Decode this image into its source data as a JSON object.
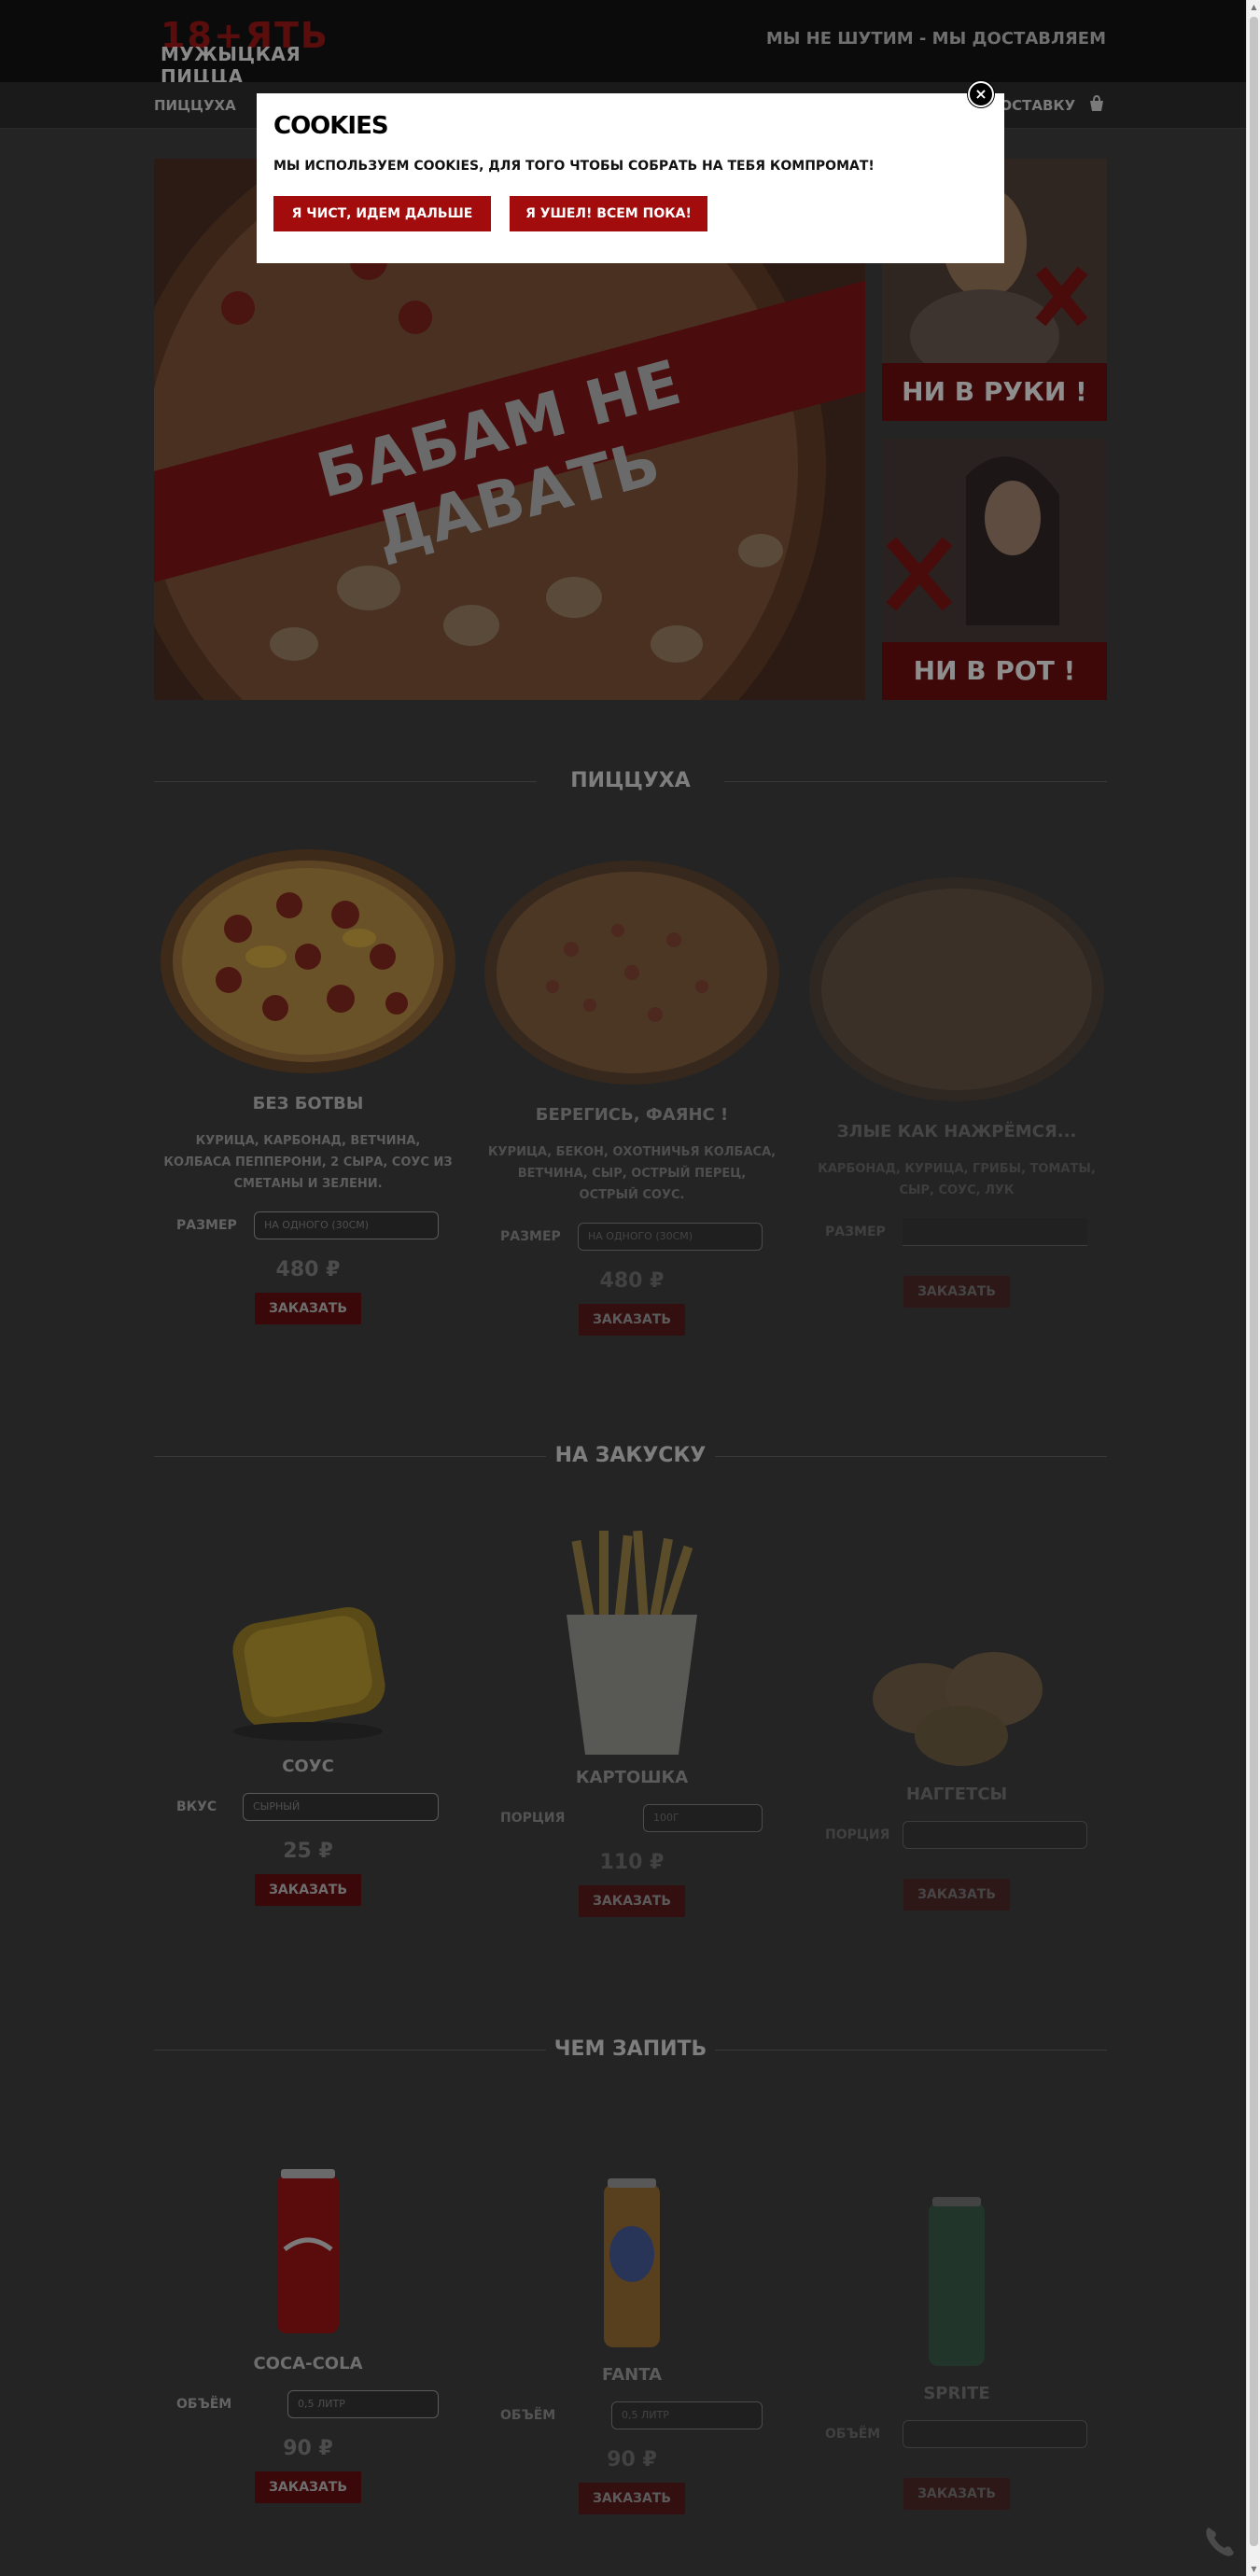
{
  "header": {
    "logo_top": "18+ЯТЬ",
    "logo_sub": "МУЖЫЦКАЯ ПИЦЦА",
    "tagline": "МЫ НЕ ШУТИМ - МЫ ДОСТАВЛЯЕМ"
  },
  "nav": {
    "items": [
      {
        "label": "ПИЦЦУХА"
      },
      {
        "label": "ДОСТАВКУ"
      }
    ]
  },
  "hero": {
    "main_text": "БАБАМ НЕ ДАВАТЬ",
    "side_top_caption": "НИ В РУКИ !",
    "side_bottom_caption": "НИ В РОТ !"
  },
  "sections": {
    "pizza": "ПИЦЦУХА",
    "snacks": "НА ЗАКУСКУ",
    "drinks": "ЧЕМ ЗАПИТЬ"
  },
  "pizzas": [
    {
      "name": "БЕЗ БОТВЫ",
      "desc": "КУРИЦА, КАРБОНАД, ВЕТЧИНА, КОЛБАСА ПЕППЕРОНИ, 2 СЫРА, СОУС ИЗ СМЕТАНЫ И ЗЕЛЕНИ.",
      "option_label": "РАЗМЕР",
      "option_value": "НА ОДНОГО (30СМ)",
      "price": "480 ₽",
      "order": "ЗАКАЗАТЬ"
    },
    {
      "name": "БЕРЕГИСЬ, ФАЯНС !",
      "desc": "КУРИЦА, БЕКОН, ОХОТНИЧЬЯ КОЛБАСА, ВЕТЧИНА, СЫР, ОСТРЫЙ ПЕРЕЦ, ОСТРЫЙ СОУС.",
      "option_label": "РАЗМЕР",
      "option_value": "НА ОДНОГО (30СМ)",
      "price": "480 ₽",
      "order": "ЗАКАЗАТЬ"
    },
    {
      "name": "ЗЛЫЕ КАК НАЖРЁМСЯ...",
      "desc": "КАРБОНАД, КУРИЦА, ГРИБЫ, ТОМАТЫ, СЫР, СОУС, ЛУК",
      "option_label": "РАЗМЕР",
      "option_value": "",
      "price": "",
      "order": "ЗАКАЗАТЬ"
    }
  ],
  "snacks": [
    {
      "name": "СОУС",
      "option_label": "ВКУС",
      "option_value": "СЫРНЫЙ",
      "price": "25 ₽",
      "order": "ЗАКАЗАТЬ"
    },
    {
      "name": "КАРТОШКА",
      "option_label": "ПОРЦИЯ",
      "option_value": "100Г",
      "price": "110 ₽",
      "order": "ЗАКАЗАТЬ"
    },
    {
      "name": "НАГГЕТСЫ",
      "option_label": "ПОРЦИЯ",
      "option_value": "",
      "price": "",
      "order": "ЗАКАЗАТЬ"
    }
  ],
  "drinks": [
    {
      "name": "COCA-COLA",
      "option_label": "ОБЪЁМ",
      "option_value": "0,5 ЛИТР",
      "price": "90 ₽",
      "order": "ЗАКАЗАТЬ"
    },
    {
      "name": "FANTA",
      "option_label": "ОБЪЁМ",
      "option_value": "0,5 ЛИТР",
      "price": "90 ₽",
      "order": "ЗАКАЗАТЬ"
    },
    {
      "name": "SPRITE",
      "option_label": "ОБЪЁМ",
      "option_value": "",
      "price": "",
      "order": "ЗАКАЗАТЬ"
    }
  ],
  "cookie_modal": {
    "title": "COOKIES",
    "text": "МЫ ИСПОЛЬЗУЕМ COOKIES, ДЛЯ ТОГО ЧТОБЫ СОБРАТЬ НА ТЕБЯ КОМПРОМАТ!",
    "accept": "Я ЧИСТ, ИДЕМ ДАЛЬШЕ",
    "decline": "Я УШЕЛ! ВСЕМ ПОКА!",
    "close": "×"
  },
  "colors": {
    "accent": "#a30c0c",
    "overlay": "#000000"
  },
  "icons": [
    "cart-icon",
    "close-icon",
    "phone-icon"
  ]
}
